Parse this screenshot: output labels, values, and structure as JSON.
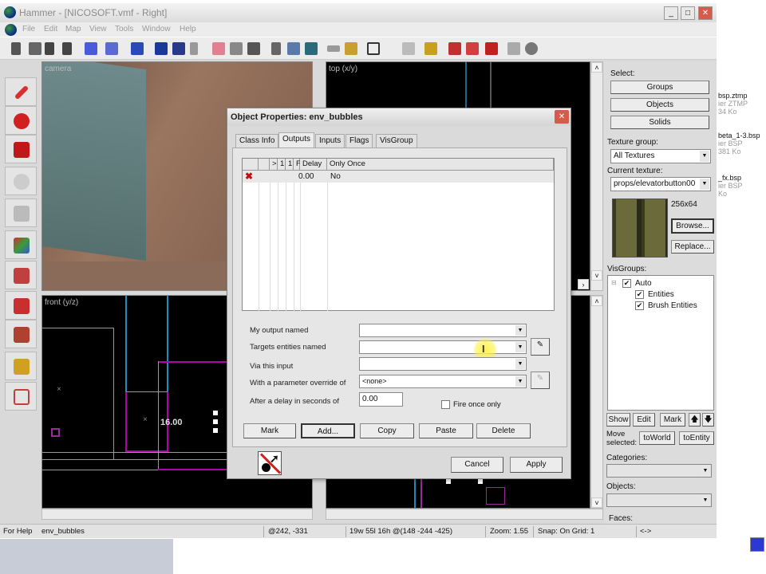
{
  "window": {
    "title": "Hammer - [NICOSOFT.vmf - Right]",
    "min": "_",
    "max": "□",
    "close": "✕"
  },
  "menu": [
    "File",
    "Edit",
    "Map",
    "View",
    "Tools",
    "Window",
    "Help"
  ],
  "viewports": {
    "camera": "camera",
    "top": "top (x/y)",
    "front": "front (y/z)",
    "front_measure": "16.00"
  },
  "right_panel": {
    "select_label": "Select:",
    "groups": "Groups",
    "objects": "Objects",
    "solids": "Solids",
    "texture_group_label": "Texture group:",
    "texture_group_value": "All Textures",
    "current_texture_label": "Current texture:",
    "current_texture_value": "props/elevatorbutton00",
    "texture_size": "256x64",
    "browse": "Browse...",
    "replace": "Replace...",
    "visgroups_label": "VisGroups:",
    "visgroups": [
      {
        "label": "Auto",
        "checked": true
      },
      {
        "label": "Entities",
        "checked": true
      },
      {
        "label": "Brush Entities",
        "checked": true
      }
    ],
    "show": "Show",
    "edit": "Edit",
    "mark": "Mark",
    "up": "🡅",
    "down": "🡇",
    "move_selected": "Move selected:",
    "to_world": "toWorld",
    "to_entity": "toEntity",
    "categories_label": "Categories:",
    "objects_label": "Objects:",
    "faces_label": "Faces:"
  },
  "dialog": {
    "title": "Object Properties: env_bubbles",
    "tabs": [
      "Class Info",
      "Outputs",
      "Inputs",
      "Flags",
      "VisGroup"
    ],
    "active_tab": "Outputs",
    "columns": [
      "",
      "",
      ">",
      "1",
      "1",
      "F",
      "Delay",
      "Only Once"
    ],
    "rows": [
      {
        "delay": "0.00",
        "only_once": "No"
      }
    ],
    "fields": {
      "output_label": "My output named",
      "output_value": "",
      "targets_label": "Targets entities named",
      "targets_value": "",
      "input_label": "Via this input",
      "input_value": "",
      "param_label": "With a parameter override of",
      "param_value": "<none>",
      "delay_label": "After a delay in seconds of",
      "delay_value": "0.00",
      "fire_once_label": "Fire once only",
      "fire_once_checked": false
    },
    "buttons": {
      "mark": "Mark",
      "add": "Add...",
      "copy": "Copy",
      "paste": "Paste",
      "delete": "Delete",
      "cancel": "Cancel",
      "apply": "Apply"
    }
  },
  "status": {
    "help": "For Help",
    "entity": "env_bubbles",
    "coords": "@242, -331",
    "size": "19w 55l 16h @(148 -244 -425)",
    "zoom": "Zoom: 1.55",
    "snap": "Snap: On Grid: 1",
    "arrows": "<->"
  },
  "background_files": [
    {
      "name": "bsp.ztmp",
      "type": "ier ZTMP",
      "size": "34 Ko"
    },
    {
      "name": "beta_1-3.bsp",
      "type": "ier BSP",
      "size": "381 Ko"
    },
    {
      "name": "_fx.bsp",
      "type": "ier BSP",
      "size": "Ko"
    }
  ],
  "colors": {
    "brush": "#b000b0",
    "selected": "#ffffff",
    "cyan_line": "#1a8fbf"
  }
}
